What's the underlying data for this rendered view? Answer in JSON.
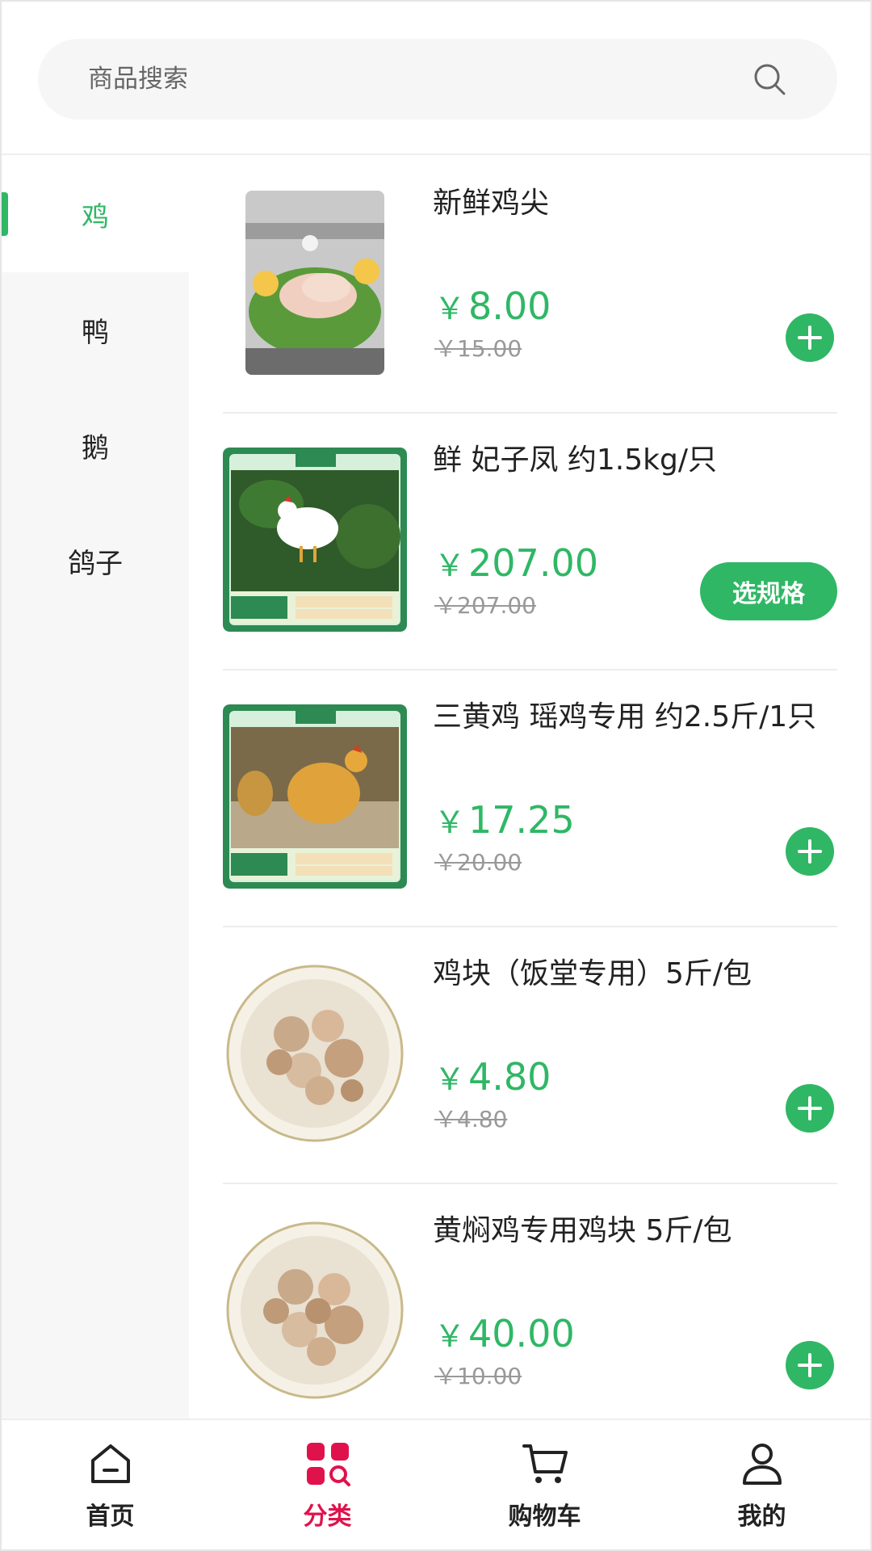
{
  "search": {
    "placeholder": "商品搜索"
  },
  "sidebar": {
    "items": [
      {
        "label": "鸡",
        "active": true
      },
      {
        "label": "鸭"
      },
      {
        "label": "鹅"
      },
      {
        "label": "鸽子"
      }
    ]
  },
  "products": [
    {
      "name": "新鲜鸡尖",
      "price": "8.00",
      "original_price": "￥15.00",
      "action": "add"
    },
    {
      "name": "鲜 妃子凤 约1.5kg/只",
      "price": "207.00",
      "original_price": "￥207.00",
      "action": "选规格"
    },
    {
      "name": "三黄鸡 瑶鸡专用 约2.5斤/1只",
      "price": "17.25",
      "original_price": "￥20.00",
      "action": "add"
    },
    {
      "name": "鸡块（饭堂专用）5斤/包",
      "price": "4.80",
      "original_price": "￥4.80",
      "action": "add"
    },
    {
      "name": "黄焖鸡专用鸡块 5斤/包",
      "price": "40.00",
      "original_price": "￥10.00",
      "action": "add"
    }
  ],
  "currency_symbol": "￥",
  "tabbar": {
    "items": [
      {
        "label": "首页",
        "icon": "home-icon"
      },
      {
        "label": "分类",
        "icon": "category-icon",
        "active": true
      },
      {
        "label": "购物车",
        "icon": "cart-icon"
      },
      {
        "label": "我的",
        "icon": "user-icon"
      }
    ]
  },
  "colors": {
    "accent": "#2fb765",
    "tab_active": "#e0124c"
  }
}
